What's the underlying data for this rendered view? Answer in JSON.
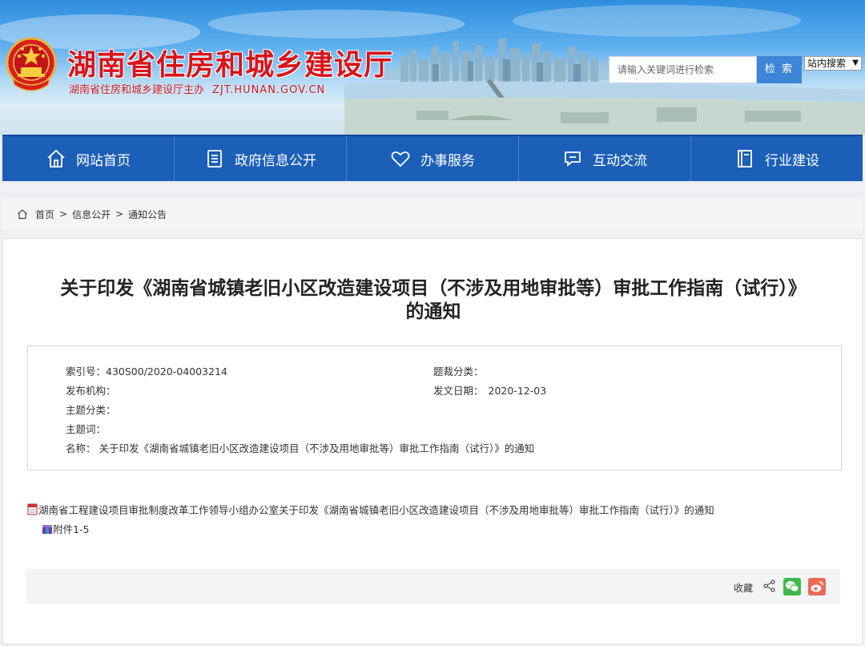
{
  "header": {
    "title": "湖南省住房和城乡建设厅",
    "subtitle": "湖南省住房和城乡建设厅主办",
    "domain": "ZJT.HUNAN.GOV.CN",
    "search_placeholder": "请输入关键词进行检索",
    "search_button": "检 索",
    "search_scope": "站内搜索"
  },
  "nav": {
    "items": [
      {
        "label": "网站首页",
        "icon": "home-icon"
      },
      {
        "label": "政府信息公开",
        "icon": "document-icon"
      },
      {
        "label": "办事服务",
        "icon": "heart-icon"
      },
      {
        "label": "互动交流",
        "icon": "chat-icon"
      },
      {
        "label": "行业建设",
        "icon": "book-icon"
      }
    ]
  },
  "breadcrumb": [
    "首页",
    "信息公开",
    "通知公告"
  ],
  "article": {
    "title_line1": "关于印发《湖南省城镇老旧小区改造建设项目（不涉及用地审批等）审批工作指南（试行）》",
    "title_line2": "的通知",
    "meta": {
      "index_label": "索引号：",
      "index_value": "430S00/2020-04003214",
      "genre_label": "题裁分类：",
      "genre_value": "",
      "publisher_label": "发布机构：",
      "publisher_value": "",
      "date_label": "发文日期：",
      "date_value": "2020-12-03",
      "topic_label": "主题分类：",
      "topic_value": "",
      "keyword_label": "主题词：",
      "keyword_value": "",
      "name_label": "名称：",
      "name_value": "关于印发《湖南省城镇老旧小区改造建设项目（不涉及用地审批等）审批工作指南（试行）》的通知"
    },
    "attachments": [
      "湖南省工程建设项目审批制度改革工作领导小组办公室关于印发《湖南省城镇老旧小区改造建设项目（不涉及用地审批等）审批工作指南（试行）》的通知",
      "附件1-5"
    ]
  },
  "share": {
    "favorite": "收藏"
  },
  "colors": {
    "nav_bg": "#1c5fb8",
    "title_red": "#d8141b",
    "search_button": "#3d86d7"
  }
}
